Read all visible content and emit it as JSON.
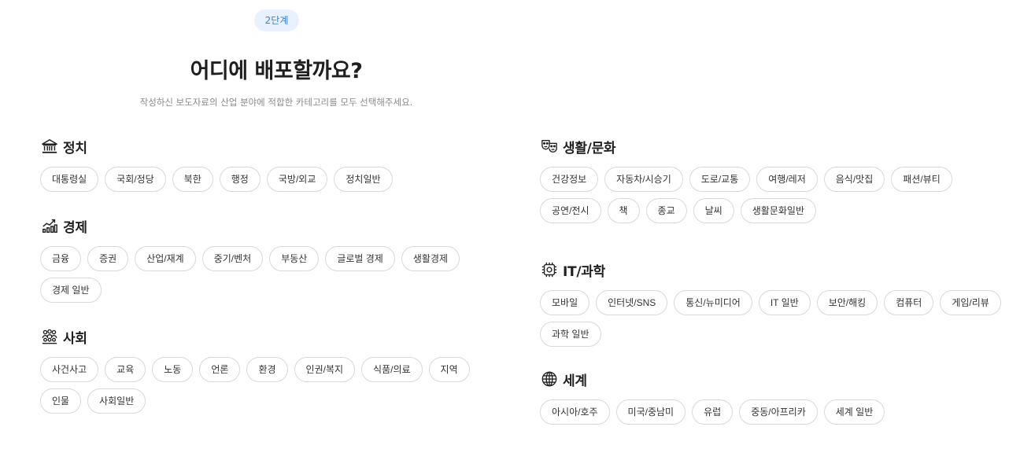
{
  "step_badge": "2단계",
  "title": "어디에 배포할까요?",
  "subtitle": "작성하신 보도자료의 산업 분야에 적합한 카테고리를 모두 선택해주세요.",
  "sections": {
    "politics": {
      "icon": "government-building-icon",
      "title": "정치",
      "items": [
        "대통령실",
        "국회/정당",
        "북한",
        "행정",
        "국방/외교",
        "정치일반"
      ]
    },
    "economy": {
      "icon": "growth-chart-icon",
      "title": "경제",
      "items": [
        "금융",
        "증권",
        "산업/재계",
        "중기/벤처",
        "부동산",
        "글로벌 경제",
        "생활경제",
        "경제 일반"
      ]
    },
    "society": {
      "icon": "people-group-icon",
      "title": "사회",
      "items": [
        "사건사고",
        "교육",
        "노동",
        "언론",
        "환경",
        "인권/복지",
        "식품/의료",
        "지역",
        "인물",
        "사회일반"
      ]
    },
    "culture": {
      "icon": "theater-masks-icon",
      "title": "생활/문화",
      "items": [
        "건강정보",
        "자동차/시승기",
        "도로/교통",
        "여행/레저",
        "음식/맛집",
        "패션/뷰티",
        "공연/전시",
        "책",
        "종교",
        "날씨",
        "생활문화일반"
      ]
    },
    "it": {
      "icon": "cpu-chip-icon",
      "title": "IT/과학",
      "items": [
        "모바일",
        "인터넷/SNS",
        "통신/뉴미디어",
        "IT 일반",
        "보안/해킹",
        "컴퓨터",
        "게임/리뷰",
        "과학 일반"
      ]
    },
    "world": {
      "icon": "globe-icon",
      "title": "세계",
      "items": [
        "아시아/호주",
        "미국/중남미",
        "유럽",
        "중동/아프리카",
        "세계 일반"
      ]
    }
  }
}
